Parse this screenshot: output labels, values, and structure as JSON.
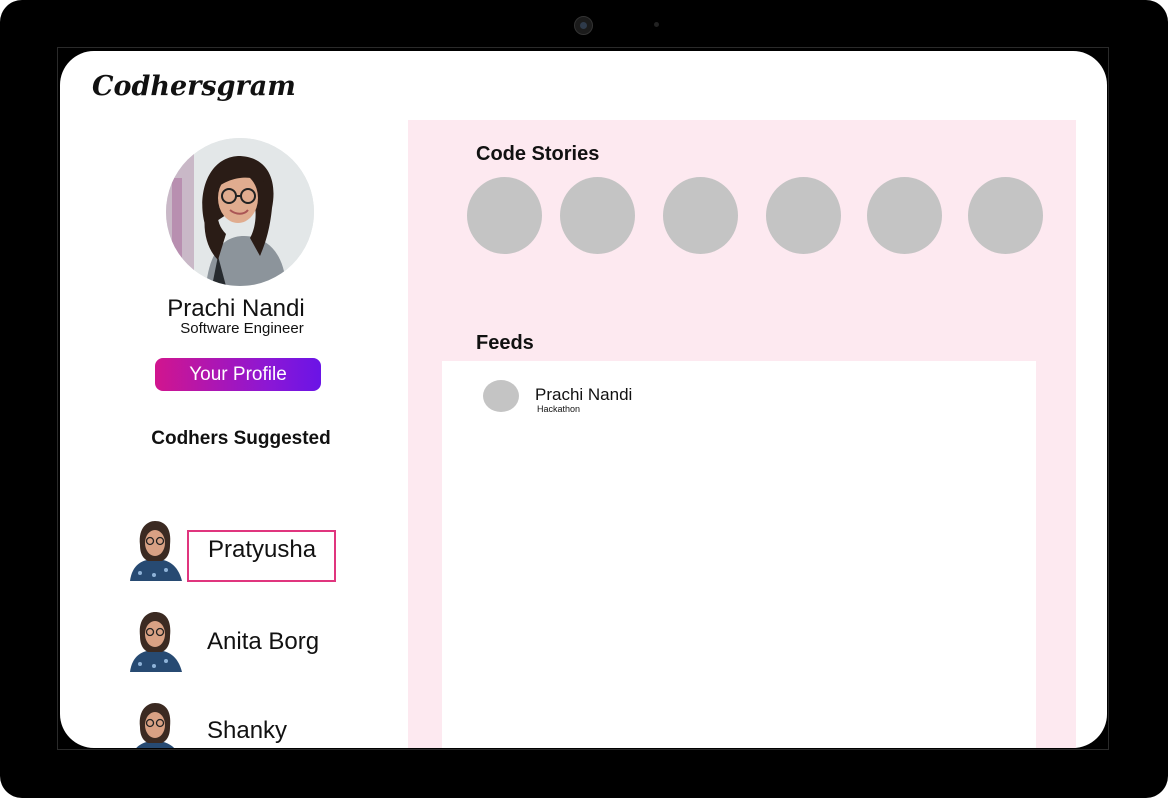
{
  "app": {
    "brand": "Codhersgram"
  },
  "profile": {
    "name": "Prachi Nandi",
    "role": "Software Engineer",
    "button_label": "Your Profile"
  },
  "suggested": {
    "title": "Codhers Suggested",
    "items": [
      {
        "name": "Pratyusha",
        "highlighted": true
      },
      {
        "name": "Anita Borg",
        "highlighted": false
      },
      {
        "name": "Shanky",
        "highlighted": false
      }
    ]
  },
  "stories": {
    "title": "Code Stories",
    "count": 6
  },
  "feeds": {
    "title": "Feeds",
    "posts": [
      {
        "author": "Prachi Nandi",
        "tag": "Hackathon"
      }
    ]
  },
  "colors": {
    "panel_bg": "#fde9f0",
    "placeholder_grey": "#c4c4c4",
    "button_gradient_start": "#d1158e",
    "button_gradient_end": "#6a14e6",
    "highlight_border": "#e0357e"
  }
}
